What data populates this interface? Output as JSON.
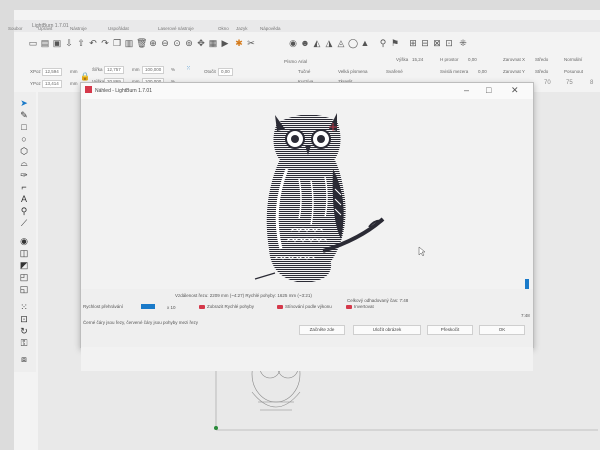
{
  "window_title": "LightBurn 1.7.01",
  "menubar": [
    "Soubor",
    "Upravit",
    "Nástroje",
    "Uspořádat",
    "Laserové nástroje",
    "Okno",
    "Jazyk",
    "Nápověda"
  ],
  "props": {
    "x_label": "XPoz",
    "x_value": "12,594",
    "x_unit": "mm",
    "y_label": "YPoz",
    "y_value": "13,414",
    "y_unit": "mm",
    "w_label": "Šířka",
    "w_value": "12,757",
    "w_unit": "mm",
    "h_label": "Výška",
    "h_value": "20,869",
    "h_unit": "mm",
    "pct_w": "100,000",
    "pct_h": "100,000",
    "pct_unit": "%",
    "rot_label": "Otočit",
    "rot_value": "0,00",
    "font_label": "Písmo",
    "font_value": "Arial",
    "bold_label": "Tučné",
    "italic_label": "Kurzíva",
    "upper_label": "Velká písmena",
    "distort_label": "Zkreslit",
    "welded_label": "Svařené",
    "hspace_label": "H prostor",
    "hspace_value": "0,00",
    "vspace_label": "Svislá mezera",
    "vspace_value": "0,00",
    "size_label": "Výška",
    "size_value": "15,24",
    "align_x_label": "Zarovnat X",
    "align_x_value": "Středo",
    "align_y_label": "Zarovnat Y",
    "align_y_value": "Středo",
    "normal_label": "Normální",
    "offset_label": "Posunout"
  },
  "ruler": [
    "70",
    "75",
    "8"
  ],
  "preview": {
    "title": "Náhled - LightBurn 1.7.01",
    "stats": "Vzdálenost řezu: 2209 mm (~4:27) Rychlé pohyby: 1625 mm (~3:21)",
    "estimated": "Celkový odhadovaný čas: 7:48",
    "time": "7:48",
    "speed_label": "Rychlost přehrávání",
    "speed_value": "x 10",
    "hint": "Černé čáry jsou řezy, červené čáry jsou pohyby mezi řezy",
    "cb_show_fast": "Zobrazit Rychlé pohyby",
    "cb_shade": "Stínování podle výkonu",
    "cb_invert": "Invertovat",
    "btn_start": "Začněte zde",
    "btn_save": "Uložit obrázek",
    "btn_print": "Přeskočit",
    "btn_ok": "OK",
    "playback_fraction": 1.0
  }
}
